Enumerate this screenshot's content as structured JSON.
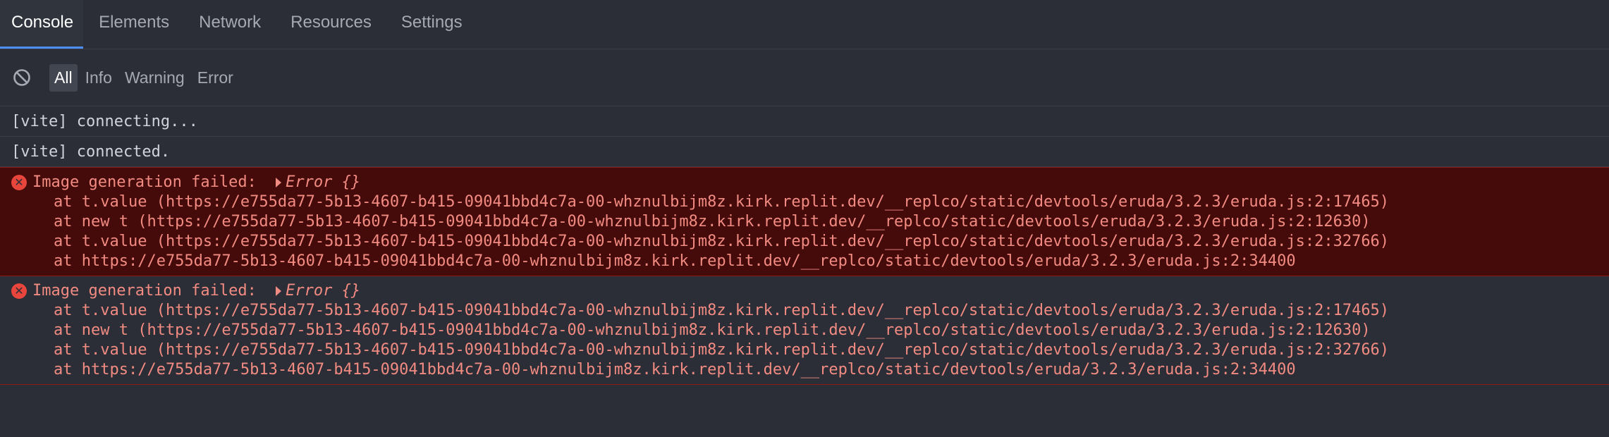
{
  "tabs": [
    {
      "label": "Console",
      "active": true
    },
    {
      "label": "Elements",
      "active": false
    },
    {
      "label": "Network",
      "active": false
    },
    {
      "label": "Resources",
      "active": false
    },
    {
      "label": "Settings",
      "active": false
    }
  ],
  "filters": {
    "clear_icon": "clear-icon",
    "items": [
      {
        "label": "All",
        "active": true
      },
      {
        "label": "Info",
        "active": false
      },
      {
        "label": "Warning",
        "active": false
      },
      {
        "label": "Error",
        "active": false
      }
    ]
  },
  "log": {
    "info": [
      "[vite] connecting...",
      "[vite] connected."
    ],
    "errors": [
      {
        "message": "Image generation failed: ",
        "object": "Error {}",
        "stack": [
          "at t.value (https://e755da77-5b13-4607-b415-09041bbd4c7a-00-whznulbijm8z.kirk.replit.dev/__replco/static/devtools/eruda/3.2.3/eruda.js:2:17465)",
          "at new t (https://e755da77-5b13-4607-b415-09041bbd4c7a-00-whznulbijm8z.kirk.replit.dev/__replco/static/devtools/eruda/3.2.3/eruda.js:2:12630)",
          "at t.value (https://e755da77-5b13-4607-b415-09041bbd4c7a-00-whznulbijm8z.kirk.replit.dev/__replco/static/devtools/eruda/3.2.3/eruda.js:2:32766)",
          "at https://e755da77-5b13-4607-b415-09041bbd4c7a-00-whznulbijm8z.kirk.replit.dev/__replco/static/devtools/eruda/3.2.3/eruda.js:2:34400"
        ]
      },
      {
        "message": "Image generation failed: ",
        "object": "Error {}",
        "stack": [
          "at t.value (https://e755da77-5b13-4607-b415-09041bbd4c7a-00-whznulbijm8z.kirk.replit.dev/__replco/static/devtools/eruda/3.2.3/eruda.js:2:17465)",
          "at new t (https://e755da77-5b13-4607-b415-09041bbd4c7a-00-whznulbijm8z.kirk.replit.dev/__replco/static/devtools/eruda/3.2.3/eruda.js:2:12630)",
          "at t.value (https://e755da77-5b13-4607-b415-09041bbd4c7a-00-whznulbijm8z.kirk.replit.dev/__replco/static/devtools/eruda/3.2.3/eruda.js:2:32766)",
          "at https://e755da77-5b13-4607-b415-09041bbd4c7a-00-whznulbijm8z.kirk.replit.dev/__replco/static/devtools/eruda/3.2.3/eruda.js:2:34400"
        ]
      }
    ]
  },
  "colors": {
    "background": "#2b2e36",
    "accent": "#4d8ff0",
    "error_text": "#f28b82",
    "error_bg": "#450a0a",
    "error_icon": "#e8453c"
  }
}
